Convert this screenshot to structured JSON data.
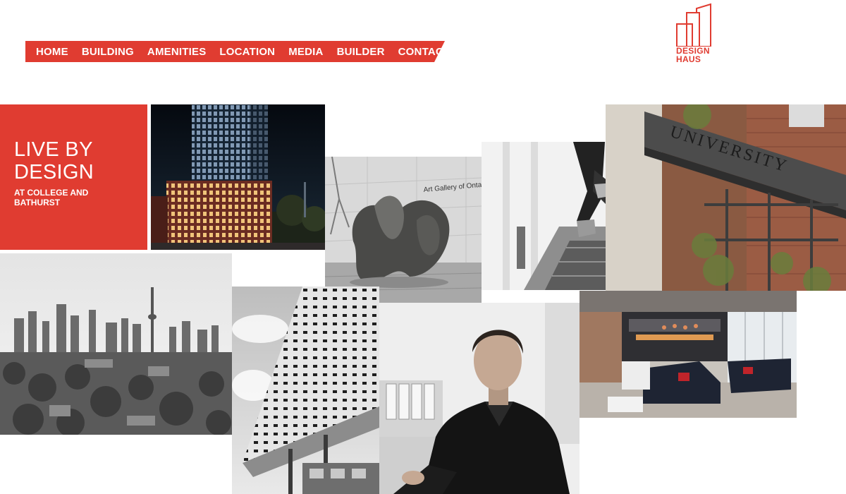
{
  "colors": {
    "accent": "#e03c31"
  },
  "nav": {
    "items": [
      "HOME",
      "BUILDING",
      "AMENITIES",
      "LOCATION",
      "MEDIA",
      "BUILDER",
      "CONTACT"
    ]
  },
  "logo": {
    "line1": "DESIGN",
    "line2": "HAUS"
  },
  "hero": {
    "title_line1": "LIVE BY",
    "title_line2": "DESIGN",
    "sub_line1": "AT COLLEGE AND",
    "sub_line2": "BATHURST"
  },
  "images": {
    "gallery_sign": "Art Gallery of Ontario",
    "university_sign": "UNIVERSITY"
  }
}
